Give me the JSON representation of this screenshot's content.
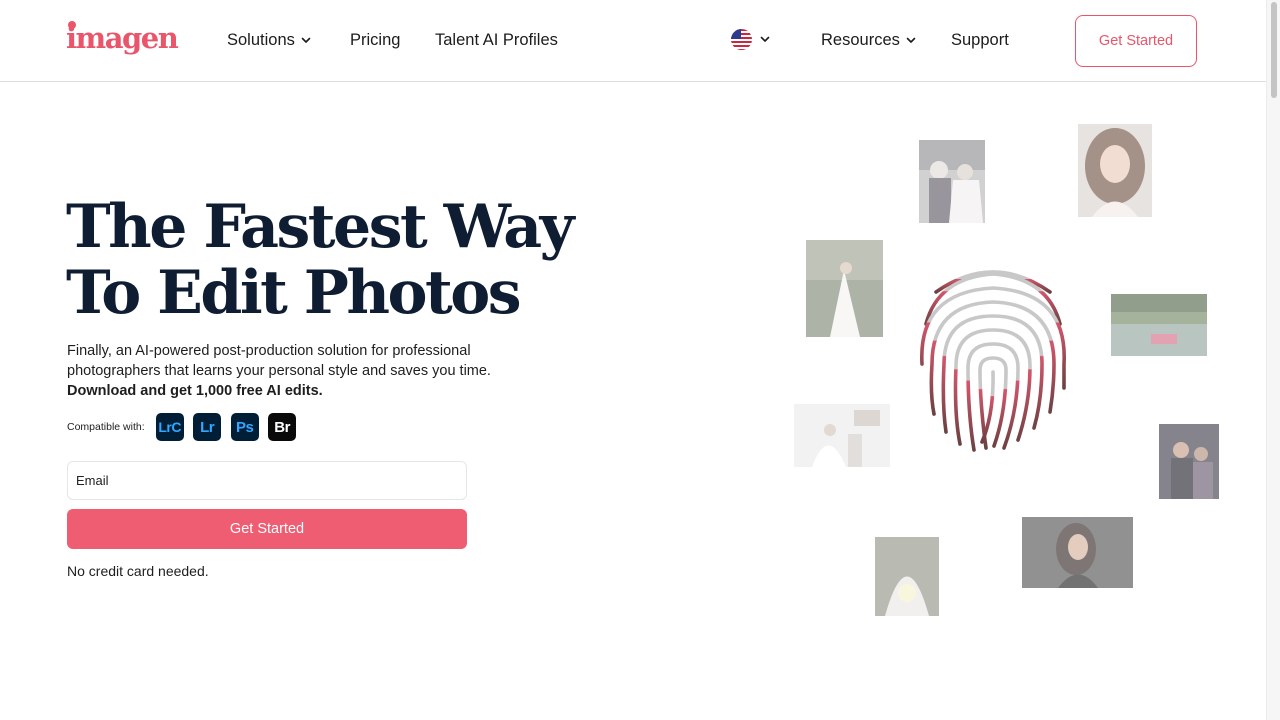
{
  "header": {
    "logo_text": "imagen",
    "nav": {
      "solutions": "Solutions",
      "pricing": "Pricing",
      "talent": "Talent AI Profiles",
      "resources": "Resources",
      "support": "Support"
    },
    "cta_label": "Get Started"
  },
  "hero": {
    "title_line1": "The Fastest Way",
    "title_line2": "To Edit Photos",
    "description": "Finally, an AI-powered post-production solution for professional photographers that learns your personal style and saves you time.",
    "description_bold": "Download and get 1,000 free AI edits.",
    "compatible_label": "Compatible with:",
    "apps": [
      {
        "label": "LrC",
        "color": "#31a8ff"
      },
      {
        "label": "Lr",
        "color": "#31a8ff"
      },
      {
        "label": "Ps",
        "color": "#31a8ff"
      },
      {
        "label": "Br",
        "color": "#ffffff"
      }
    ],
    "email_placeholder": "Email",
    "cta_label": "Get Started",
    "note": "No credit card needed."
  },
  "colors": {
    "brand": "#e9566b",
    "cta": "#ef5d73",
    "title": "#0f1d33",
    "app_badge_bg": "#001e36"
  }
}
